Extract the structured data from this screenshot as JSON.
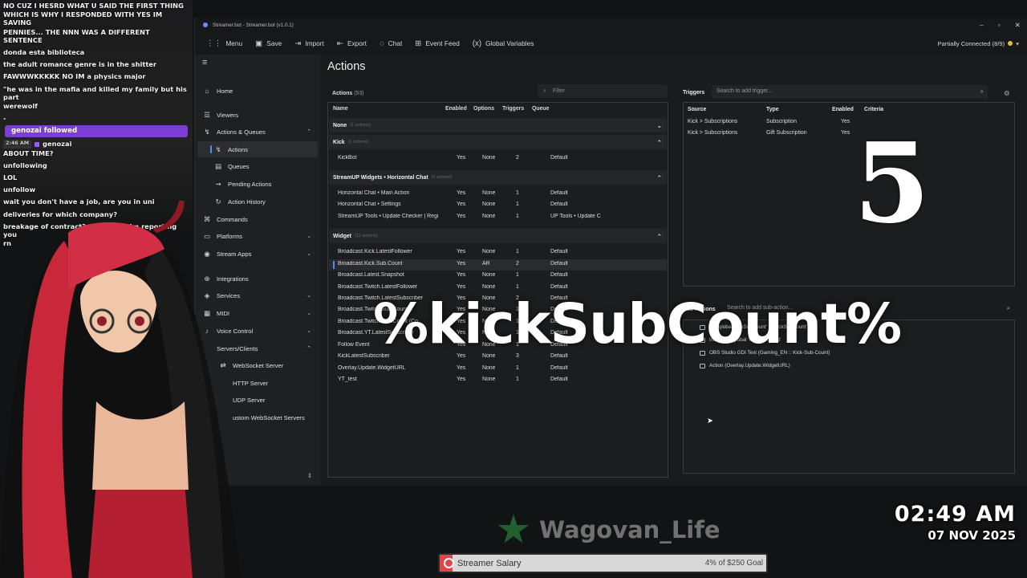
{
  "chat": {
    "lines_top": [
      "NO CUZ I HESRD WHAT U SAID THE FIRST THING",
      "WHICH IS WHY I RESPONDED WITH YES IM SAVING",
      "PENNIES... THE NNN WAS A DIFFERENT SENTENCE",
      "donda esta biblioteca",
      "the adult romance genre is in the shitter",
      "FAWWWKKKKK NO IM a physics major",
      "\"he was in the mafia and killed my family but his part",
      "werewolf",
      "-"
    ],
    "follow_notice": "genozai followed",
    "time": "2:46 AM",
    "user": "genozai",
    "lines_bottom": [
      "ABOUT TIME?",
      "unfollowing",
      "LOL",
      "unfollow",
      "wait you don't have a job, are you in uni",
      "deliveries for which company?",
      "breakage of contract? you buddy im reporting you",
      "rn"
    ]
  },
  "window": {
    "title": "Streamer.bot - Streamer.bot (v1.0.1)",
    "controls": [
      "–",
      "▫",
      "✕"
    ],
    "menu": [
      {
        "icon": "⋮⋮",
        "label": "Menu"
      },
      {
        "icon": "▣",
        "label": "Save"
      },
      {
        "icon": "⇥",
        "label": "Import"
      },
      {
        "icon": "⇤",
        "label": "Export"
      },
      {
        "icon": "◌",
        "label": "Chat"
      },
      {
        "icon": "⊞",
        "label": "Event Feed"
      },
      {
        "icon": "(x)",
        "label": "Global Variables"
      }
    ],
    "connection": "Partially Connected (8/9)"
  },
  "sidebar": {
    "items": [
      {
        "label": "Home",
        "icon": "⌂"
      },
      {
        "label": "Viewers",
        "icon": "☰"
      },
      {
        "label": "Actions & Queues",
        "icon": "↯"
      },
      {
        "label": "Actions",
        "icon": "↯"
      },
      {
        "label": "Queues",
        "icon": "▤"
      },
      {
        "label": "Pending Actions",
        "icon": "⇝"
      },
      {
        "label": "Action History",
        "icon": "↻"
      },
      {
        "label": "Commands",
        "icon": "⌘"
      },
      {
        "label": "Platforms",
        "icon": "▭"
      },
      {
        "label": "Stream Apps",
        "icon": "◉"
      },
      {
        "label": "Integrations",
        "icon": "⊕"
      },
      {
        "label": "Services",
        "icon": "◈"
      },
      {
        "label": "MIDI",
        "icon": "▦"
      },
      {
        "label": "Voice Control",
        "icon": "♪"
      },
      {
        "label": "Servers/Clients",
        "icon": ""
      },
      {
        "label": "WebSocket Server",
        "icon": "⇄"
      },
      {
        "label": "HTTP Server",
        "icon": ""
      },
      {
        "label": "UDP Server",
        "icon": ""
      },
      {
        "label": "ustom WebSocket Servers",
        "icon": ""
      }
    ]
  },
  "actions": {
    "title": "Actions",
    "panel_label": "Actions",
    "count": "(53)",
    "filter_placeholder": "Filter",
    "columns": [
      "Name",
      "Enabled",
      "Options",
      "Triggers",
      "Queue"
    ],
    "groups": [
      {
        "name": "None",
        "count": "(1 actions)"
      },
      {
        "name": "Kick",
        "count": "(1 actions)"
      },
      {
        "name": "StreamUP Widgets • Horizontal Chat",
        "count": "(3 actions)"
      },
      {
        "name": "Widget",
        "count": "(12 actions)"
      }
    ],
    "rows": [
      [
        "KickBot",
        "Yes",
        "None",
        "2",
        "Default"
      ],
      [
        "Horizontal Chat • Main Action",
        "Yes",
        "None",
        "1",
        "Default"
      ],
      [
        "Horizontal Chat • Settings",
        "Yes",
        "None",
        "1",
        "Default"
      ],
      [
        "StreamUP Tools • Update Checker | Regi",
        "Yes",
        "None",
        "1",
        "UP Tools • Update C"
      ],
      [
        "Broadcast.Kick.LatestFollower",
        "Yes",
        "None",
        "1",
        "Default"
      ],
      [
        "Broadcast.Kick.Sub.Count",
        "Yes",
        "AR",
        "2",
        "Default"
      ],
      [
        "Broadcast.Latest.Snapshot",
        "Yes",
        "None",
        "1",
        "Default"
      ],
      [
        "Broadcast.Twitch.LatestFollower",
        "Yes",
        "None",
        "1",
        "Default"
      ],
      [
        "Broadcast.Twitch.LatestSubscriber",
        "Yes",
        "None",
        "2",
        "Default"
      ],
      [
        "Broadcast.Twitch.Sub.Count",
        "Yes",
        "None",
        "1",
        "Default"
      ],
      [
        "Broadcast.Twitch.Sub.Count (Co",
        "Yes",
        "None",
        "1",
        "Default"
      ],
      [
        "Broadcast.YT.LatestSubscriber",
        "Yes",
        "None",
        "1",
        "Default"
      ],
      [
        "Follow Event",
        "Yes",
        "None",
        "1",
        "Default"
      ],
      [
        "KickLatestSubscriber",
        "Yes",
        "None",
        "3",
        "Default"
      ],
      [
        "Overlay.Update.WidgetURL",
        "Yes",
        "None",
        "1",
        "Default"
      ],
      [
        "YT_test",
        "Yes",
        "None",
        "1",
        "Default"
      ]
    ]
  },
  "triggers": {
    "title": "Triggers",
    "search_placeholder": "Search to add trigger...",
    "columns": [
      "Source",
      "Type",
      "Enabled",
      "Criteria"
    ],
    "rows": [
      [
        "Kick > Subscriptions",
        "Subscription",
        "Yes",
        ""
      ],
      [
        "Kick > Subscriptions",
        "Gift Subscription",
        "Yes",
        ""
      ]
    ]
  },
  "subactions": {
    "title": "Sub-Actions",
    "search_placeholder": "Search to add sub-action...",
    "items": [
      "Get global 'kickSubCount' to 'kickSubCount'",
      "Increment global 'kickSubCount'",
      "OBS Studio GDI Text (Gaming_EN :: Kick-Sub-Count)",
      "Action (Overlay.Update.WidgetURL)"
    ]
  },
  "overlay": {
    "big_number": "5",
    "big_text": "%kickSubCount%",
    "clock_time": "02:49 AM",
    "clock_date": "07 NOV 2025",
    "brand": "Wagovan_Life",
    "salary_label": "Streamer Salary",
    "salary_goal": "4% of $250 Goal",
    "salary_progress": 0.04
  },
  "colors": {
    "accent": "#4d8dff",
    "follow": "#7b3fd6",
    "status_dot": "#e6c229",
    "brand": "#2e9d4a",
    "salary_fill": "#e04848"
  }
}
